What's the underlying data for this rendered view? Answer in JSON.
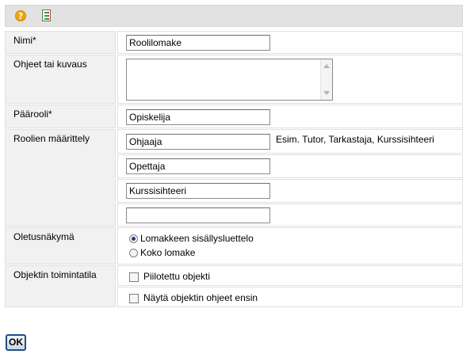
{
  "toolbar": {
    "help_icon": "help-icon",
    "form_icon": "form-icon"
  },
  "form": {
    "name": {
      "label": "Nimi*",
      "value": "Roolilomake"
    },
    "description": {
      "label": "Ohjeet tai kuvaus",
      "value": ""
    },
    "main_role": {
      "label": "Päärooli*",
      "value": "Opiskelija"
    },
    "roles": {
      "label": "Roolien määrittely",
      "hint": "Esim. Tutor, Tarkastaja, Kurssisihteeri",
      "values": [
        "Ohjaaja",
        "Opettaja",
        "Kurssisihteeri",
        ""
      ]
    },
    "default_view": {
      "label": "Oletusnäkymä",
      "options": [
        "Lomakkeen sisällysluettelo",
        "Koko lomake"
      ],
      "selected": "Lomakkeen sisällysluettelo"
    },
    "object_mode": {
      "label": "Objektin toimintatila",
      "options": [
        "Piilotettu objekti",
        "Näytä objektin ohjeet ensin"
      ]
    }
  },
  "ok_label": "OK",
  "colors": {
    "label_bg": "#f1f1f1",
    "border": "#e0e0e0",
    "toolbar_bg": "#e2e2e2",
    "ok_border": "#1d4f86"
  }
}
